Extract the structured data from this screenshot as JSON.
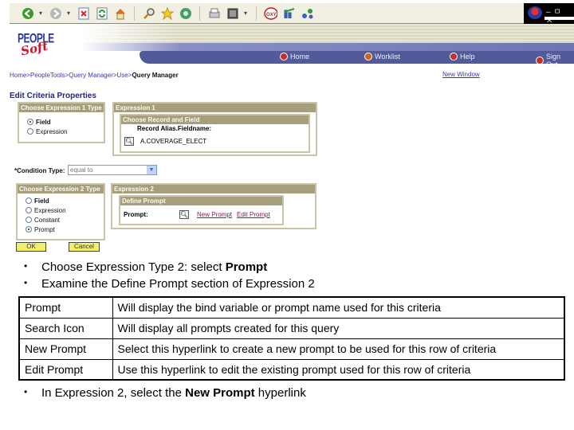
{
  "browser": {
    "toolbar_icons": [
      "back-icon",
      "forward-icon",
      "stop-icon",
      "refresh-icon",
      "home-icon",
      "search-icon",
      "favorites-icon",
      "media-icon",
      "print-icon",
      "edit-icon",
      "oxy-icon",
      "chart-icon",
      "network-icon"
    ],
    "window_controls": [
      "minimize",
      "restore",
      "close"
    ]
  },
  "header": {
    "logo_top": "PEOPLE",
    "logo_bottom": "Soft",
    "nav": [
      {
        "label": "Home"
      },
      {
        "label": "Worklist"
      },
      {
        "label": "Help"
      },
      {
        "label": "Sign Out"
      }
    ]
  },
  "breadcrumb": {
    "items": [
      "Home",
      "PeopleTools",
      "Query Manager",
      "Use"
    ],
    "separator": " > ",
    "current": "Query Manager"
  },
  "new_window": "New Window",
  "page_title": "Edit Criteria Properties",
  "expr1_type": {
    "title": "Choose Expression 1 Type",
    "options": [
      {
        "label": "Field",
        "selected": true
      },
      {
        "label": "Expression",
        "selected": false
      }
    ]
  },
  "expr1": {
    "title": "Expression 1",
    "sub_title": "Choose Record and Field",
    "field_label": "Record Alias.Fieldname:",
    "field_value": "A.COVERAGE_ELECT"
  },
  "condition": {
    "label": "*Condition Type:",
    "value": "equal to"
  },
  "expr2_type": {
    "title": "Choose Expression 2 Type",
    "options": [
      {
        "label": "Field",
        "selected": false
      },
      {
        "label": "Expression",
        "selected": false
      },
      {
        "label": "Constant",
        "selected": false
      },
      {
        "label": "Prompt",
        "selected": true
      }
    ]
  },
  "expr2": {
    "title": "Expression 2",
    "sub_title": "Define Prompt",
    "prompt_label": "Prompt:",
    "new_prompt": "New Prompt",
    "edit_prompt": "Edit Prompt"
  },
  "buttons": {
    "ok": "OK",
    "cancel": "Cancel"
  },
  "slide": {
    "bullets_top": [
      {
        "text": "Choose Expression Type 2: select ",
        "bold": "Prompt",
        "after": ""
      },
      {
        "text": "Examine the Define Prompt section of Expression 2",
        "bold": "",
        "after": ""
      }
    ],
    "table": [
      {
        "term": "Prompt",
        "desc": "Will display the bind variable or prompt name used for this criteria"
      },
      {
        "term": "Search Icon",
        "desc": "Will display all prompts created for this query"
      },
      {
        "term": "New Prompt",
        "desc": "Select this hyperlink to create a new prompt to be used for this row of criteria"
      },
      {
        "term": "Edit Prompt",
        "desc": "Use this hyperlink to edit the existing prompt used for this row of criteria"
      }
    ],
    "bullet_bottom": {
      "text": "In Expression 2, select the ",
      "bold": "New Prompt",
      "after": " hyperlink"
    },
    "bullet_char": "•"
  }
}
